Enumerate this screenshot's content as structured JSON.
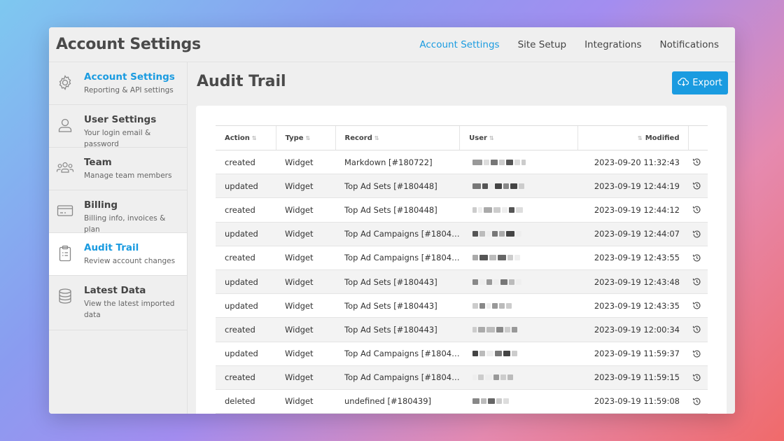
{
  "app_title": "Account Settings",
  "top_nav": [
    {
      "label": "Account Settings",
      "active": true
    },
    {
      "label": "Site Setup",
      "active": false
    },
    {
      "label": "Integrations",
      "active": false
    },
    {
      "label": "Notifications",
      "active": false
    }
  ],
  "sidebar": {
    "items": [
      {
        "title": "Account Settings",
        "subtitle": "Reporting & API settings",
        "icon": "gear-icon"
      },
      {
        "title": "User Settings",
        "subtitle": "Your login email & password",
        "icon": "user-icon"
      },
      {
        "title": "Team",
        "subtitle": "Manage team members",
        "icon": "team-icon"
      },
      {
        "title": "Billing",
        "subtitle": "Billing info, invoices & plan",
        "icon": "credit-card-icon"
      },
      {
        "title": "Audit Trail",
        "subtitle": "Review account changes",
        "icon": "clipboard-icon"
      },
      {
        "title": "Latest Data",
        "subtitle": "View the latest imported data",
        "icon": "database-icon"
      }
    ]
  },
  "main": {
    "title": "Audit Trail",
    "export_label": "Export"
  },
  "table": {
    "headers": {
      "action": "Action",
      "type": "Type",
      "record": "Record",
      "user": "User",
      "modified": "Modified"
    },
    "rows": [
      {
        "action": "created",
        "type": "Widget",
        "record": "Markdown [#180722]",
        "modified": "2023-09-20 11:32:43"
      },
      {
        "action": "updated",
        "type": "Widget",
        "record": "Top Ad Sets [#180448]",
        "modified": "2023-09-19 12:44:19"
      },
      {
        "action": "created",
        "type": "Widget",
        "record": "Top Ad Sets [#180448]",
        "modified": "2023-09-19 12:44:12"
      },
      {
        "action": "updated",
        "type": "Widget",
        "record": "Top Ad Campaigns [#1804…",
        "modified": "2023-09-19 12:44:07"
      },
      {
        "action": "created",
        "type": "Widget",
        "record": "Top Ad Campaigns [#1804…",
        "modified": "2023-09-19 12:43:55"
      },
      {
        "action": "updated",
        "type": "Widget",
        "record": "Top Ad Sets [#180443]",
        "modified": "2023-09-19 12:43:48"
      },
      {
        "action": "updated",
        "type": "Widget",
        "record": "Top Ad Sets [#180443]",
        "modified": "2023-09-19 12:43:35"
      },
      {
        "action": "created",
        "type": "Widget",
        "record": "Top Ad Sets [#180443]",
        "modified": "2023-09-19 12:00:34"
      },
      {
        "action": "updated",
        "type": "Widget",
        "record": "Top Ad Campaigns [#1804…",
        "modified": "2023-09-19 11:59:37"
      },
      {
        "action": "created",
        "type": "Widget",
        "record": "Top Ad Campaigns [#1804…",
        "modified": "2023-09-19 11:59:15"
      },
      {
        "action": "deleted",
        "type": "Widget",
        "record": "undefined [#180439]",
        "modified": "2023-09-19 11:59:08"
      }
    ]
  },
  "colors": {
    "accent": "#1a9be0",
    "text": "#444444"
  }
}
